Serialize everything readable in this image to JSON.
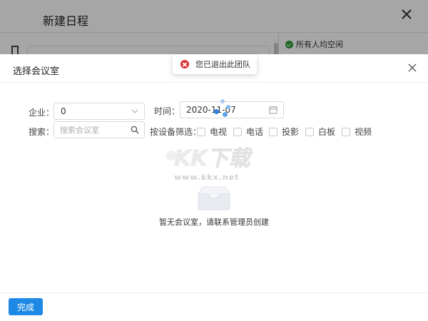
{
  "background_window": {
    "title": "新建日程",
    "availability_text": "所有人均空闲"
  },
  "toast": {
    "message": "您已退出此团队",
    "icon": "error-icon",
    "color": "#e03030"
  },
  "modal": {
    "title": "选择会议室",
    "filters": {
      "company_label": "企业：",
      "company_value": "0",
      "time_label": "时间：",
      "date_value": "2020-11-07",
      "search_label": "搜索：",
      "search_placeholder": "搜索会议室",
      "equipment_label": "按设备筛选：",
      "equipment_options": [
        "电视",
        "电话",
        "投影",
        "白板",
        "视频"
      ]
    },
    "empty_state": {
      "message": "暂无会议室，请联系管理员创建"
    },
    "footer": {
      "done_label": "完成"
    }
  },
  "watermark": {
    "logo_text": "KK下载",
    "url": "www.kkx.net"
  },
  "colors": {
    "primary": "#1e88e5",
    "success": "#2e9e3a",
    "error": "#e03030"
  }
}
